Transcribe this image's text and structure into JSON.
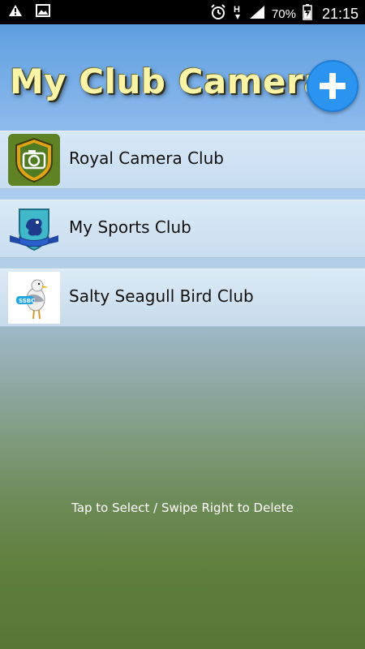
{
  "status_bar": {
    "icons_left": [
      "warning-icon",
      "image-icon"
    ],
    "icons_right": [
      "alarm-icon",
      "data-h-icon",
      "signal-icon",
      "battery-charging-icon"
    ],
    "battery": "70%",
    "time": "21:15"
  },
  "header": {
    "title": "My Club Camera",
    "add_button_icon": "plus-icon"
  },
  "clubs": [
    {
      "name": "Royal Camera Club",
      "logo": "camera-shield-logo"
    },
    {
      "name": "My Sports Club",
      "logo": "lion-crest-logo"
    },
    {
      "name": "Salty Seagull Bird Club",
      "logo": "seagull-logo"
    }
  ],
  "hint": "Tap to Select / Swipe Right to Delete",
  "colors": {
    "title_text": "#fbf4a6",
    "add_button": "#2b94f0",
    "status_bar": "#000000"
  }
}
